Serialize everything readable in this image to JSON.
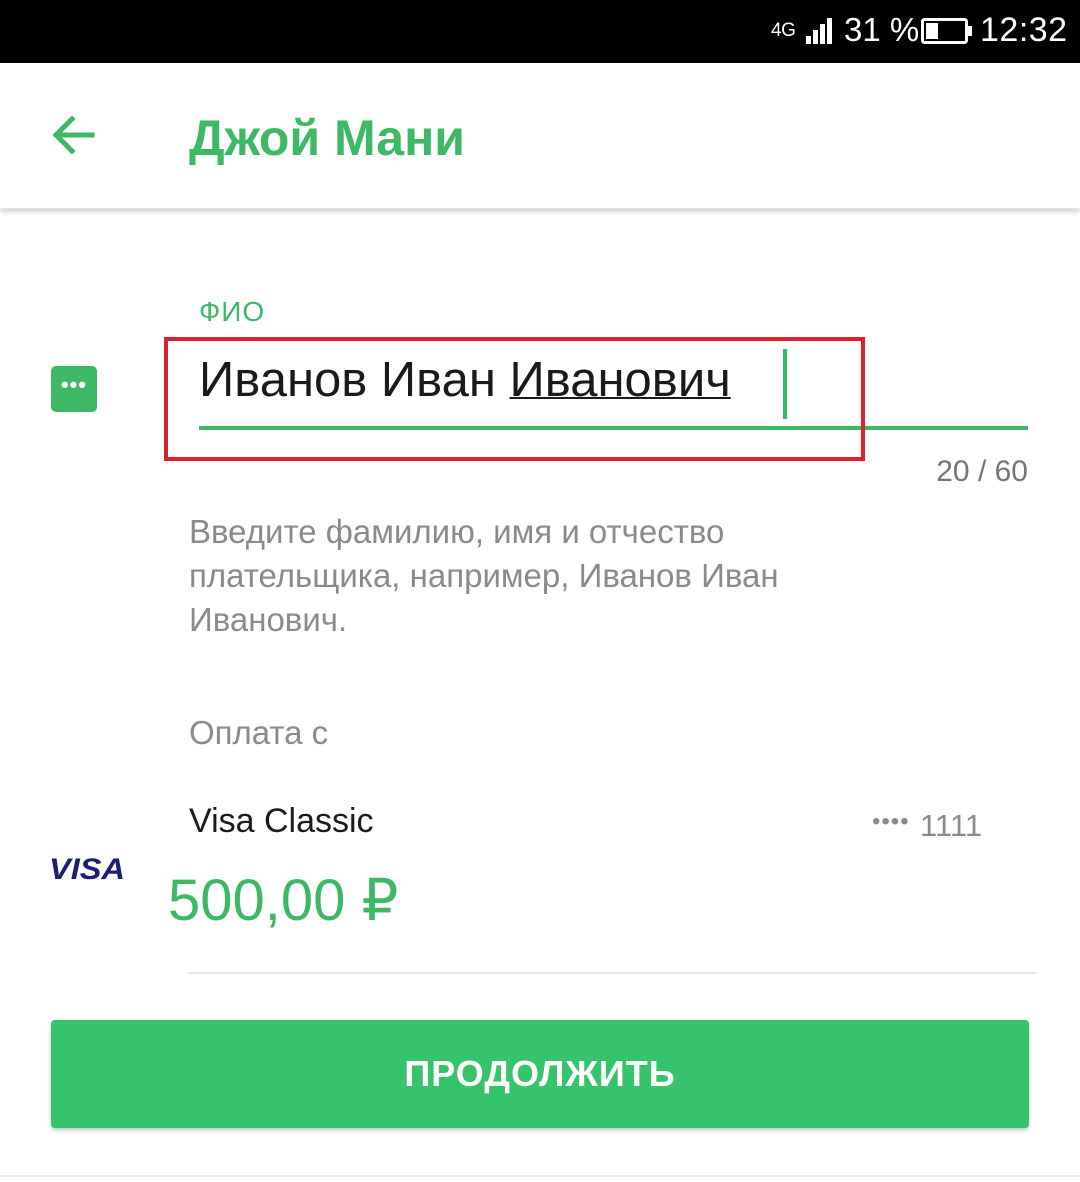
{
  "status_bar": {
    "network": "4G",
    "signal_icon": "signal-strength-icon",
    "battery_percent": "31 %",
    "battery_icon": "battery-icon",
    "battery_level": 0.31,
    "time": "12:32"
  },
  "app_bar": {
    "back_icon": "arrow-left-icon",
    "title": "Джой Мани"
  },
  "form": {
    "field_label": "ФИО",
    "field_icon": "more-dots-icon",
    "value_plain": "Иванов Иван ",
    "value_composing": "Иванович",
    "counter": "20 / 60",
    "hint": "Введите фамилию, имя и отчество плательщика, например, Иванов Иван Иванович."
  },
  "payment": {
    "label": "Оплата с",
    "card_logo": "VISA",
    "card_name": "Visa Classic",
    "card_mask": "••••",
    "card_last4": "1111",
    "balance": "500,00 ₽"
  },
  "continue_button": "ПРОДОЛЖИТЬ",
  "colors": {
    "brand_green": "#3db865",
    "button_green": "#35c46c",
    "highlight_red": "#e0202c",
    "visa_blue": "#1a1f71"
  }
}
